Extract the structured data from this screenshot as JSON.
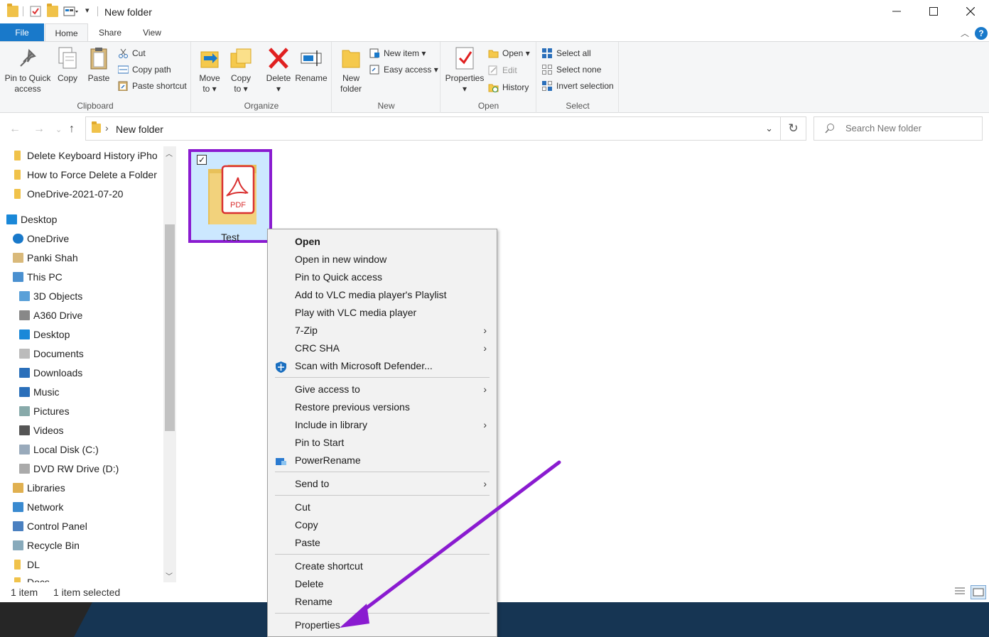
{
  "window": {
    "title": "New folder",
    "minimize_icon": "minimize-icon",
    "maximize_icon": "maximize-icon",
    "close_icon": "close-icon"
  },
  "quick_access_toolbar": {
    "dropdown_glyph": "▾"
  },
  "ribbon_tabs": [
    {
      "label": "File"
    },
    {
      "label": "Home"
    },
    {
      "label": "Share"
    },
    {
      "label": "View"
    }
  ],
  "ribbon": {
    "clipboard": {
      "title": "Clipboard",
      "pin_label": "Pin to Quick\naccess",
      "copy_label": "Copy",
      "paste_label": "Paste",
      "cut_label": "Cut",
      "copy_path_label": "Copy path",
      "paste_shortcut_label": "Paste shortcut"
    },
    "organize": {
      "title": "Organize",
      "move_to_label": "Move\nto ▾",
      "copy_to_label": "Copy\nto ▾",
      "delete_label": "Delete\n▾",
      "rename_label": "Rename"
    },
    "new": {
      "title": "New",
      "new_folder_label": "New\nfolder",
      "new_item_label": "New item ▾",
      "easy_access_label": "Easy access ▾"
    },
    "open": {
      "title": "Open",
      "properties_label": "Properties\n▾",
      "open_label": "Open ▾",
      "edit_label": "Edit",
      "history_label": "History"
    },
    "select": {
      "title": "Select",
      "select_all_label": "Select all",
      "select_none_label": "Select none",
      "invert_label": "Invert selection"
    }
  },
  "address": {
    "path": "New folder",
    "search_placeholder": "Search New folder"
  },
  "nav_items": [
    {
      "label": "Delete Keyboard History iPho",
      "icon": "folder-icon"
    },
    {
      "label": "How to Force Delete a Folder",
      "icon": "folder-icon"
    },
    {
      "label": "OneDrive-2021-07-20",
      "icon": "folder-icon"
    },
    {
      "label": "Desktop",
      "icon": "desktop-icon"
    },
    {
      "label": "OneDrive",
      "icon": "cloud-icon"
    },
    {
      "label": "Panki Shah",
      "icon": "user-folder-icon"
    },
    {
      "label": "This PC",
      "icon": "computer-icon"
    },
    {
      "label": "3D Objects",
      "icon": "cube-icon"
    },
    {
      "label": "A360 Drive",
      "icon": "drive-icon"
    },
    {
      "label": "Desktop",
      "icon": "desktop-icon"
    },
    {
      "label": "Documents",
      "icon": "documents-icon"
    },
    {
      "label": "Downloads",
      "icon": "download-icon"
    },
    {
      "label": "Music",
      "icon": "music-icon"
    },
    {
      "label": "Pictures",
      "icon": "pictures-icon"
    },
    {
      "label": "Videos",
      "icon": "videos-icon"
    },
    {
      "label": "Local Disk (C:)",
      "icon": "disk-icon"
    },
    {
      "label": "DVD RW Drive (D:)",
      "icon": "dvd-icon"
    },
    {
      "label": "Libraries",
      "icon": "libraries-icon"
    },
    {
      "label": "Network",
      "icon": "network-icon"
    },
    {
      "label": "Control Panel",
      "icon": "control-panel-icon"
    },
    {
      "label": "Recycle Bin",
      "icon": "recycle-bin-icon"
    },
    {
      "label": "DL",
      "icon": "folder-icon"
    },
    {
      "label": "Docs",
      "icon": "folder-icon"
    }
  ],
  "file": {
    "name": "Test",
    "badge": "PDF",
    "checked": "✓"
  },
  "status": {
    "count": "1 item",
    "selected": "1 item selected"
  },
  "context_menu": {
    "items": [
      {
        "label": "Open",
        "bold": true
      },
      {
        "label": "Open in new window"
      },
      {
        "label": "Pin to Quick access"
      },
      {
        "label": "Add to VLC media player's Playlist"
      },
      {
        "label": "Play with VLC media player"
      },
      {
        "label": "7-Zip",
        "submenu": true
      },
      {
        "label": "CRC SHA",
        "submenu": true
      },
      {
        "label": "Scan with Microsoft Defender...",
        "icon": "defender-shield-icon"
      },
      {
        "label": "Give access to",
        "submenu": true
      },
      {
        "label": "Restore previous versions"
      },
      {
        "label": "Include in library",
        "submenu": true
      },
      {
        "label": "Pin to Start"
      },
      {
        "label": "PowerRename",
        "icon": "powerrename-icon"
      },
      {
        "label": "Send to",
        "submenu": true
      },
      {
        "label": "Cut"
      },
      {
        "label": "Copy"
      },
      {
        "label": "Paste"
      },
      {
        "label": "Create shortcut"
      },
      {
        "label": "Delete"
      },
      {
        "label": "Rename"
      },
      {
        "label": "Properties"
      }
    ],
    "submenu_glyph": "›"
  },
  "colors": {
    "file_tab": "#1979ca",
    "selection_outline": "#8a1bd0",
    "selected_bg": "#cce8ff",
    "annotation_arrow": "#8a1bd0",
    "taskbar": "#163553"
  }
}
